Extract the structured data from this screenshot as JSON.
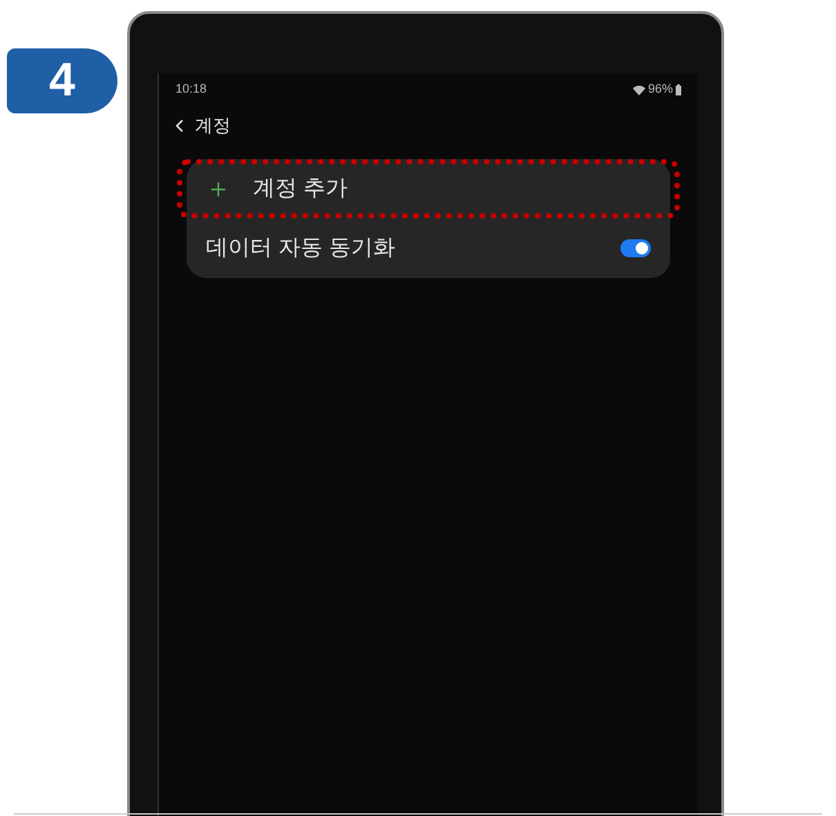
{
  "step_badge": "4",
  "status_bar": {
    "time": "10:18",
    "battery": "96%"
  },
  "header": {
    "title": "계정"
  },
  "settings": [
    {
      "kind": "action",
      "label": "계정 추가",
      "highlighted": true
    },
    {
      "kind": "toggle",
      "label": "데이터 자동 동기화",
      "on": true,
      "highlighted": false
    }
  ]
}
